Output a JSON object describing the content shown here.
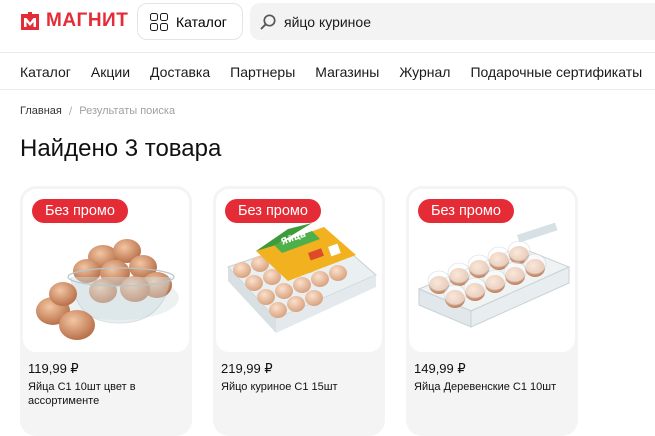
{
  "header": {
    "logo_text": "МАГНИТ",
    "catalog_label": "Каталог",
    "search_value": "яйцо куриное"
  },
  "nav": {
    "items": [
      "Каталог",
      "Акции",
      "Доставка",
      "Партнеры",
      "Магазины",
      "Журнал",
      "Подарочные сертификаты"
    ]
  },
  "breadcrumb": {
    "home": "Главная",
    "separator": "/",
    "current": "Результаты поиска"
  },
  "page": {
    "title": "Найдено 3 товара"
  },
  "products": [
    {
      "badge": "Без промо",
      "price": "119,99 ₽",
      "name": "Яйца С1 10шт цвет в ассортименте"
    },
    {
      "badge": "Без промо",
      "price": "219,99 ₽",
      "name": "Яйцо куриное С1 15шт",
      "pack_label": "Яйца"
    },
    {
      "badge": "Без промо",
      "price": "149,99 ₽",
      "name": "Яйца Деревенские С1 10шт"
    }
  ],
  "colors": {
    "brand_red": "#e52b36",
    "card_bg": "#f4f4f4",
    "search_bg": "#f3f3f3"
  },
  "icons": [
    "magnit-logo-icon",
    "catalog-grid-icon",
    "search-icon"
  ]
}
